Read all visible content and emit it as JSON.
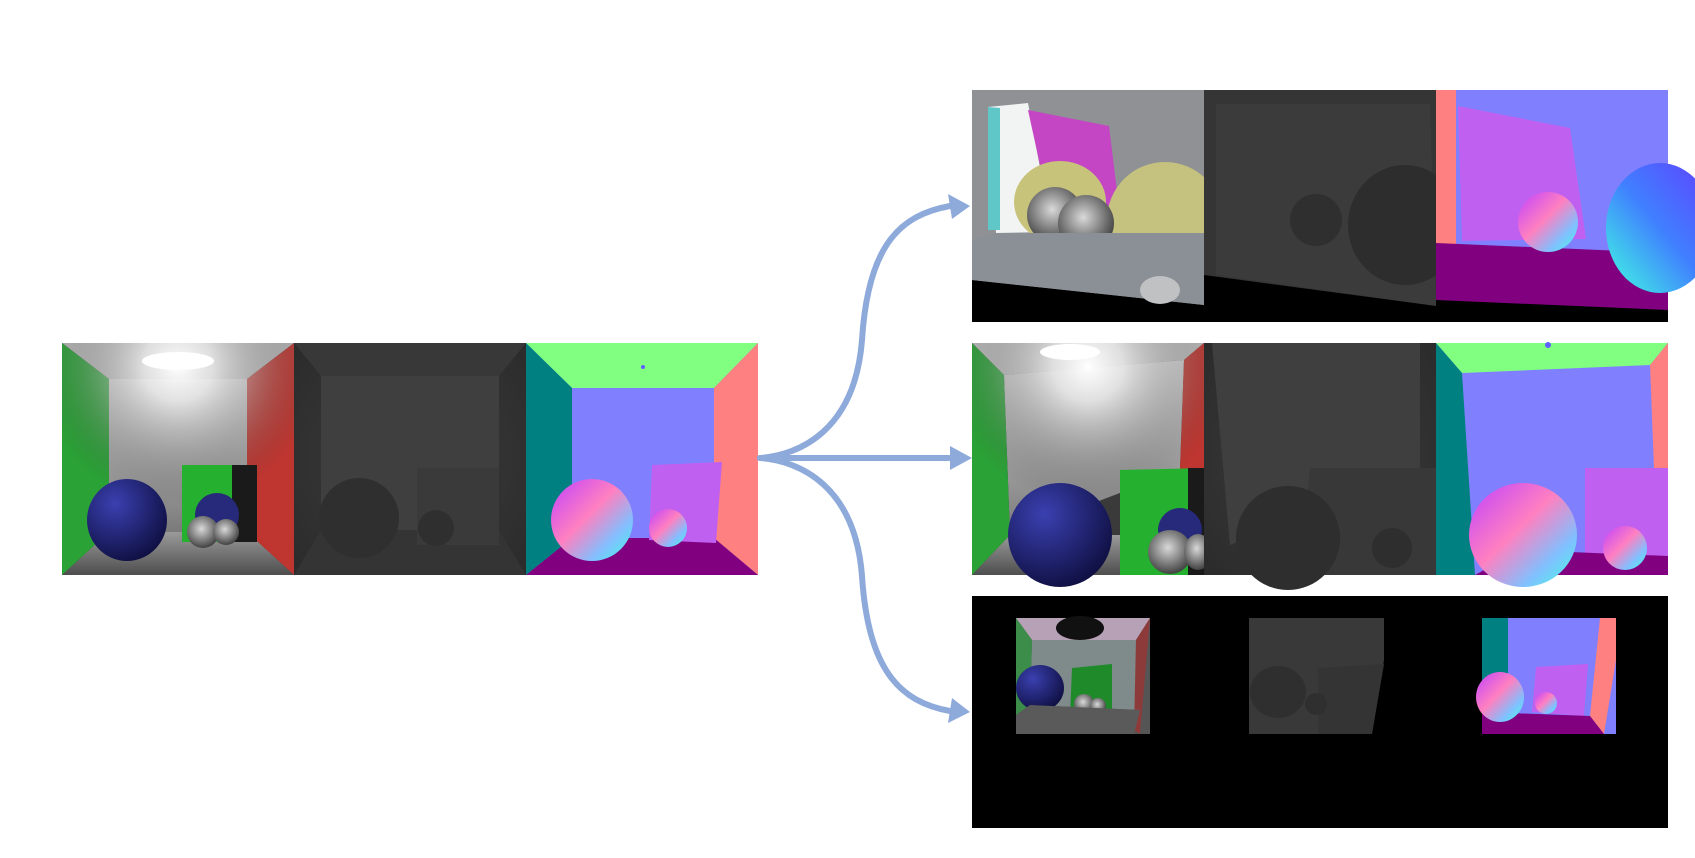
{
  "figure": {
    "background": "#ffffff",
    "arrow_color": "#8eaadb",
    "arrow_count": 3
  },
  "input_strip": {
    "panels": [
      "render-buffer",
      "depth-buffer",
      "normal-buffer"
    ]
  },
  "output_strips": [
    {
      "variant": "cropped-close-view",
      "panels": [
        "render-buffer",
        "depth-buffer",
        "normal-buffer"
      ]
    },
    {
      "variant": "shifted-view",
      "panels": [
        "render-buffer",
        "depth-buffer",
        "normal-buffer"
      ]
    },
    {
      "variant": "shrunk-padded-view",
      "panels": [
        "render-buffer",
        "depth-buffer",
        "normal-buffer"
      ]
    }
  ],
  "colors": {
    "wall_left_render": "#2fa83a",
    "wall_right_render": "#c23a34",
    "ceiling_render": "#cfcfcf",
    "sphere_render": "#26287a",
    "depth_gray": "#3d3d3d",
    "normal_back": "#8080ff",
    "normal_top": "#80ff80",
    "normal_left": "#008080",
    "normal_right": "#ff8080",
    "normal_floor": "#800080",
    "normal_box": "#c060f0"
  }
}
